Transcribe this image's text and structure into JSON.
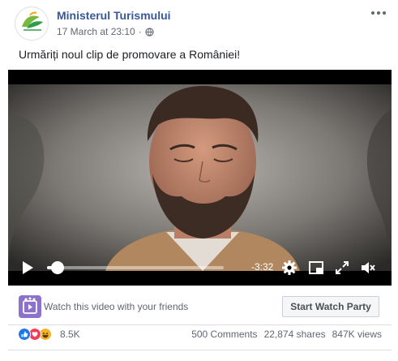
{
  "post": {
    "page_name": "Ministerul Turismului",
    "timestamp": "17 March at 23:10",
    "separator": "·",
    "privacy_icon": "globe-icon",
    "avatar_logo_text": "România",
    "caption": "Urmăriți noul clip de promovare a României!"
  },
  "video": {
    "progress": 0.06,
    "time_remaining": "-3:32",
    "icons": [
      "play-icon",
      "settings-icon",
      "picture-in-picture-icon",
      "fullscreen-icon",
      "volume-icon"
    ]
  },
  "watch_party": {
    "prompt": "Watch this video with your friends",
    "button_label": "Start Watch Party",
    "icon": "watch-party-icon",
    "accent": "#8c72cb"
  },
  "reactions": {
    "types": [
      "like",
      "love",
      "haha"
    ],
    "colors": {
      "like": "#1877f2",
      "love": "#f33e58",
      "haha": "#f7b125"
    },
    "count": "8.5K"
  },
  "stats": {
    "comments": "500 Comments",
    "shares": "22,874 shares",
    "views": "847K views"
  },
  "colors": {
    "link": "#385898",
    "muted": "#606770"
  }
}
